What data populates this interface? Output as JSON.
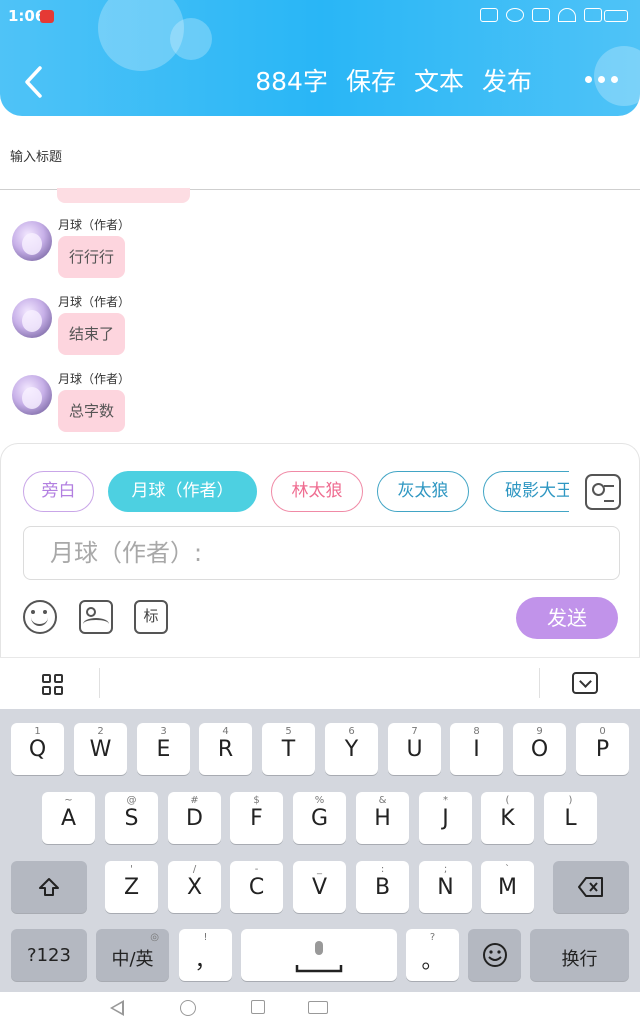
{
  "status_bar": {
    "time": "1:06"
  },
  "header": {
    "actions": [
      "884字",
      "保存",
      "文本",
      "发布"
    ]
  },
  "title_input": {
    "placeholder": "输入标题"
  },
  "messages": [
    {
      "name": "月球（作者）",
      "text": "行行行"
    },
    {
      "name": "月球（作者）",
      "text": "结束了"
    },
    {
      "name": "月球（作者）",
      "text": "总字数"
    }
  ],
  "composer": {
    "roles": [
      "旁白",
      "月球（作者）",
      "林太狼",
      "灰太狼",
      "破影大王"
    ],
    "selected_role": "月球（作者）",
    "input_placeholder": "月球（作者）:",
    "tag_label": "标",
    "send_label": "发送"
  },
  "keyboard": {
    "row1": [
      {
        "main": "Q",
        "sub": "1"
      },
      {
        "main": "W",
        "sub": "2"
      },
      {
        "main": "E",
        "sub": "3"
      },
      {
        "main": "R",
        "sub": "4"
      },
      {
        "main": "T",
        "sub": "5"
      },
      {
        "main": "Y",
        "sub": "6"
      },
      {
        "main": "U",
        "sub": "7"
      },
      {
        "main": "I",
        "sub": "8"
      },
      {
        "main": "O",
        "sub": "9"
      },
      {
        "main": "P",
        "sub": "0"
      }
    ],
    "row2": [
      {
        "main": "A",
        "sub": "~"
      },
      {
        "main": "S",
        "sub": "@"
      },
      {
        "main": "D",
        "sub": "#"
      },
      {
        "main": "F",
        "sub": "$"
      },
      {
        "main": "G",
        "sub": "%"
      },
      {
        "main": "H",
        "sub": "&"
      },
      {
        "main": "J",
        "sub": "*"
      },
      {
        "main": "K",
        "sub": "("
      },
      {
        "main": "L",
        "sub": ")"
      }
    ],
    "row3": [
      {
        "main": "Z",
        "sub": "'"
      },
      {
        "main": "X",
        "sub": "/"
      },
      {
        "main": "C",
        "sub": "-"
      },
      {
        "main": "V",
        "sub": "_"
      },
      {
        "main": "B",
        "sub": ":"
      },
      {
        "main": "N",
        "sub": ";"
      },
      {
        "main": "M",
        "sub": "`"
      }
    ],
    "num_label": "?123",
    "lang_label": "中/英",
    "comma_label": "，",
    "comma_sub": "!",
    "period_label": "。",
    "period_sub": "?",
    "enter_label": "换行"
  }
}
